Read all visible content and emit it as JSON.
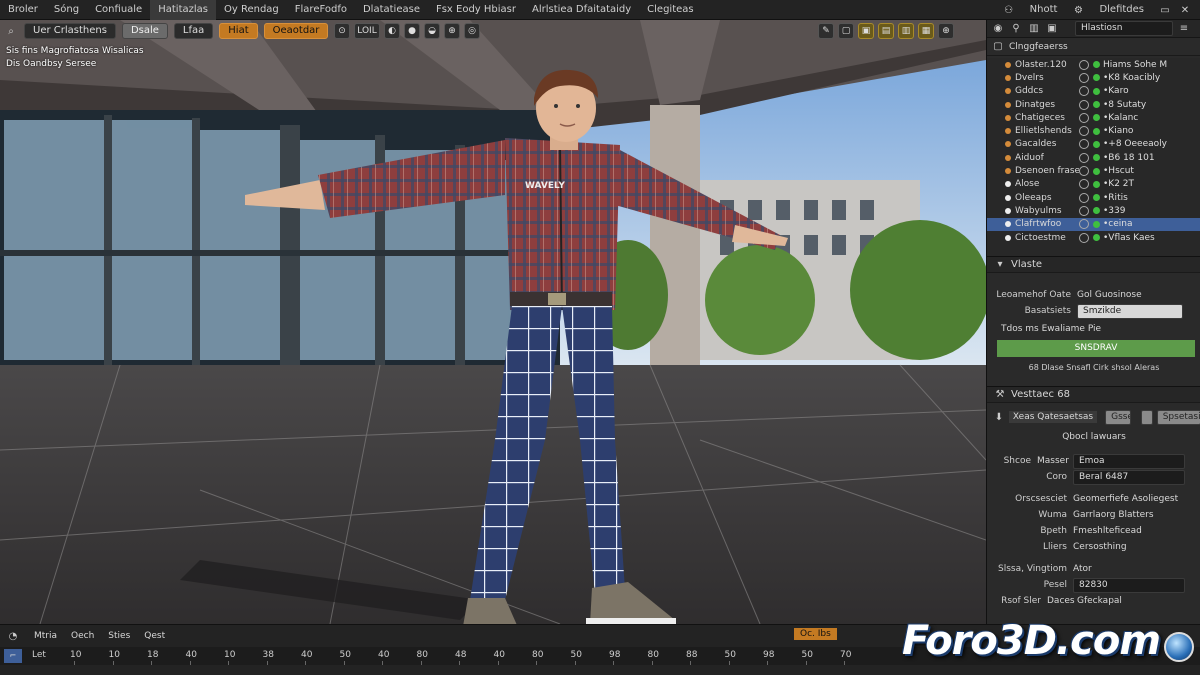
{
  "menu": {
    "items": [
      "Broler",
      "Sóng",
      "Confiuale",
      "Hatitazlas",
      "Oy Rendag",
      "FlareFodfo",
      "Dlatatiease",
      "Fsx Eody Hbiasr",
      "Alrlstiea Dfaitataidy",
      "Clegiteas"
    ],
    "active_index": 3,
    "right_items": [
      "Nhott",
      "Dlefitdes"
    ]
  },
  "viewport": {
    "header": {
      "mode_label": "Uer Crlasthens",
      "btn2": "Dsale",
      "btn3": "Lfaa",
      "btn4": "Hiat",
      "btn5": "Oeaotdar"
    },
    "overlay_line1": "Sis fins Magrofiatosa Wisalicas",
    "overlay_line2": "Dis Oandbsy Sersee",
    "tools": [
      "⊙",
      "LOIL",
      "◐",
      "●",
      "◒",
      "⊕",
      "◎"
    ],
    "tools2": [
      "✎",
      "▢",
      "▣",
      "▤",
      "▥",
      "▦",
      "⊕"
    ],
    "shirt_text": "WAVELY",
    "colors": {
      "shirt": "#8e3e3e",
      "pants": "#2d3e6e",
      "floor": "#3d3b3c"
    }
  },
  "right_panel": {
    "search_value": "Hlastiosn",
    "outliner_title": "Clnggfeaerss",
    "outliner_rows": [
      {
        "name": "Olaster.120",
        "value": "Hiams Sohe M",
        "color": "#d48b3a"
      },
      {
        "name": "Dvelrs",
        "value": "•K8  Koacibly",
        "color": "#d48b3a"
      },
      {
        "name": "Gddcs",
        "value": "•Karo",
        "color": "#d48b3a"
      },
      {
        "name": "Dinatges",
        "value": "•8   Sutaty",
        "color": "#d48b3a"
      },
      {
        "name": "Chatigeces",
        "value": "•Kalanc",
        "color": "#d48b3a"
      },
      {
        "name": "Ellietlshends",
        "value": "•Kiano",
        "color": "#d48b3a"
      },
      {
        "name": "Gacaldes",
        "value": "•+8  Oeeeaoly",
        "color": "#d48b3a"
      },
      {
        "name": "Aiduof",
        "value": "•B6 18 101",
        "color": "#d48b3a"
      },
      {
        "name": "Dsenoen frase",
        "value": "•Hscut",
        "color": "#d48b3a"
      },
      {
        "name": "Alose",
        "value": "•K2 2T",
        "color": "#eeeeee"
      },
      {
        "name": "Oleeaps",
        "value": "•Ritis",
        "color": "#eeeeee"
      },
      {
        "name": "Wabyulms",
        "value": "•339",
        "color": "#eeeeee"
      },
      {
        "name": "Clafrtwfoo",
        "value": "•ceina",
        "color": "#eeeeee"
      },
      {
        "name": "Cictoestme",
        "value": "•Vflas Kaes",
        "color": "#eeeeee"
      }
    ],
    "selected_row": 12,
    "section1": {
      "title": "Vlaste",
      "row1_label": "Leoamehof Oate",
      "row1_value": "Gol Guosinose",
      "row2_label": "Basatsiets",
      "row2_value": "Smzikde",
      "row3_label": "Tdos ms Ewaliame Pie",
      "green_button": "SNSDRAV",
      "footer_text": "68 Dlase Snsafl Cirk shsol Aleras"
    },
    "section2": {
      "tab_label": "Vesttaec 68",
      "header_label": "Xeas Qatesaetsas",
      "btn_a": "Gsse",
      "btn_b": "Spsetasiase",
      "sub_label": "Qbocl lawuars",
      "row_a_label": "Shcoe",
      "row_a_label2": "Masser",
      "row_a_value": "Emoa",
      "row_b_label": "Coro",
      "row_b_value": "Beral",
      "row_b_value2": "6487",
      "row_c_label": "Orscsesciet",
      "row_c_value": "Geomerfiefe Asoliegest",
      "row_d_label": "Wuma",
      "row_d_value": "Garrlaorg Blatters",
      "row_e_label": "Bpeth",
      "row_e_value": "Fmeshlteficead",
      "row_f_label": "Lliers",
      "row_f_value": "Cersosthing",
      "row_g_label": "Slssa, Vingtiom",
      "row_g_value": "Ator",
      "row_h_label": "Pesel",
      "row_h_value": "82830",
      "row_i_label": "Rsof Sler",
      "row_i_value": "Daces",
      "row_i_value2": "Gfeckapal"
    }
  },
  "timeline": {
    "head_items": [
      "Mtria",
      "Oech",
      "Sties",
      "Qest"
    ],
    "frame_label": "Let",
    "ticks": [
      "10",
      "10",
      "18",
      "40",
      "10",
      "38",
      "40",
      "50",
      "40",
      "80",
      "48",
      "40",
      "80",
      "50",
      "98",
      "80",
      "88",
      "50",
      "98",
      "50",
      "70"
    ],
    "orange_btn": "Oc. Ibs"
  },
  "logo_text": "Foro3D.com"
}
